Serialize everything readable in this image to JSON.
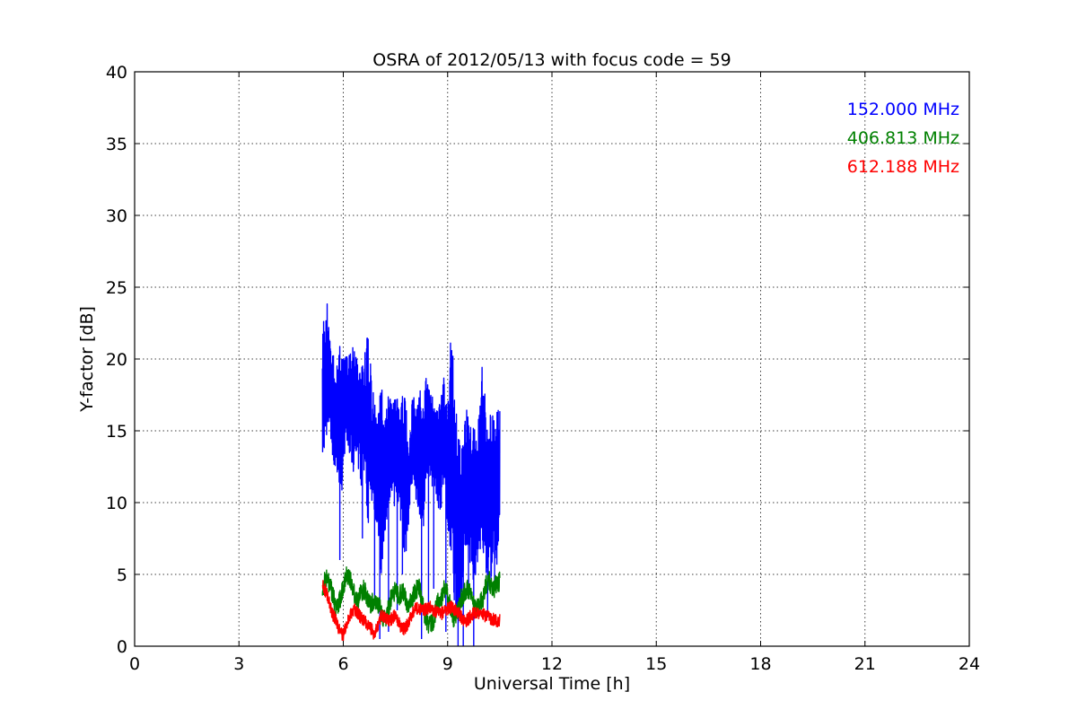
{
  "chart_data": {
    "type": "line",
    "title": "OSRA of 2012/05/13 with focus code = 59",
    "xlabel": "Universal Time [h]",
    "ylabel": "Y-factor [dB]",
    "xlim": [
      0,
      24
    ],
    "ylim": [
      0,
      40
    ],
    "xticks": [
      0,
      3,
      6,
      9,
      12,
      15,
      18,
      21,
      24
    ],
    "yticks": [
      0,
      5,
      10,
      15,
      20,
      25,
      30,
      35,
      40
    ],
    "grid": true,
    "legend_placement": "top-right",
    "series": [
      {
        "name": "152.000 MHz",
        "color": "#0000ff",
        "x": [
          5.4,
          5.5,
          5.6,
          5.7,
          5.8,
          5.9,
          6.0,
          6.1,
          6.2,
          6.3,
          6.4,
          6.5,
          6.6,
          6.7,
          6.8,
          6.9,
          7.0,
          7.1,
          7.2,
          7.3,
          7.4,
          7.5,
          7.6,
          7.7,
          7.8,
          7.9,
          8.0,
          8.1,
          8.2,
          8.3,
          8.4,
          8.5,
          8.6,
          8.7,
          8.8,
          8.9,
          9.0,
          9.1,
          9.2,
          9.3,
          9.4,
          9.5,
          9.6,
          9.7,
          9.8,
          9.9,
          10.0,
          10.1,
          10.2,
          10.3,
          10.4,
          10.5
        ],
        "min": [
          13.0,
          14.0,
          15.0,
          13.0,
          12.0,
          9.0,
          12.0,
          14.0,
          13.0,
          12.0,
          13.0,
          11.0,
          12.0,
          8.0,
          10.0,
          9.0,
          6.0,
          5.0,
          7.0,
          9.0,
          10.0,
          9.0,
          10.0,
          7.0,
          6.0,
          9.0,
          12.0,
          10.0,
          9.0,
          8.0,
          11.0,
          12.0,
          10.0,
          10.0,
          9.0,
          11.0,
          8.0,
          6.0,
          2.0,
          1.0,
          3.0,
          7.0,
          6.0,
          5.0,
          4.0,
          6.0,
          7.0,
          5.0,
          3.0,
          6.0,
          5.0,
          7.0
        ],
        "max": [
          22.0,
          25.0,
          22.0,
          21.0,
          20.0,
          21.5,
          21.0,
          21.0,
          20.5,
          21.0,
          20.0,
          20.5,
          19.5,
          23.5,
          19.0,
          17.0,
          18.0,
          18.0,
          18.0,
          17.5,
          17.0,
          18.0,
          16.5,
          18.0,
          17.5,
          14.0,
          18.0,
          17.5,
          18.0,
          17.0,
          19.5,
          18.0,
          17.5,
          16.5,
          17.5,
          19.0,
          16.0,
          23.8,
          18.0,
          15.5,
          14.0,
          17.0,
          16.0,
          15.5,
          15.0,
          16.0,
          20.0,
          16.5,
          16.0,
          17.0,
          16.5,
          16.8
        ],
        "spikes_down": [
          [
            5.9,
            6.0
          ],
          [
            6.55,
            7.5
          ],
          [
            6.9,
            3.0
          ],
          [
            7.05,
            0.5
          ],
          [
            7.3,
            1.0
          ],
          [
            7.55,
            2.5
          ],
          [
            7.7,
            5.0
          ],
          [
            8.25,
            0.5
          ],
          [
            8.45,
            3.0
          ],
          [
            8.6,
            4.0
          ],
          [
            8.95,
            1.0
          ],
          [
            9.3,
            0.0
          ],
          [
            9.45,
            0.0
          ],
          [
            9.6,
            4.0
          ],
          [
            9.75,
            0.0
          ],
          [
            10.15,
            2.0
          ],
          [
            10.35,
            4.0
          ]
        ]
      },
      {
        "name": "406.813 MHz",
        "color": "#008000",
        "x": [
          5.4,
          5.5,
          5.6,
          5.7,
          5.8,
          5.9,
          6.0,
          6.1,
          6.2,
          6.3,
          6.4,
          6.5,
          6.6,
          6.7,
          6.8,
          6.9,
          7.0,
          7.1,
          7.2,
          7.3,
          7.4,
          7.5,
          7.6,
          7.7,
          7.8,
          7.9,
          8.0,
          8.1,
          8.2,
          8.3,
          8.4,
          8.5,
          8.6,
          8.7,
          8.8,
          8.9,
          9.0,
          9.1,
          9.2,
          9.3,
          9.4,
          9.5,
          9.6,
          9.7,
          9.8,
          9.9,
          10.0,
          10.1,
          10.2,
          10.3,
          10.4,
          10.5
        ],
        "y": [
          4.0,
          4.8,
          4.3,
          3.5,
          2.6,
          3.2,
          4.0,
          5.0,
          4.7,
          3.8,
          3.2,
          3.6,
          4.0,
          3.4,
          2.9,
          3.2,
          3.0,
          2.2,
          1.8,
          2.6,
          3.6,
          3.9,
          3.5,
          3.8,
          3.2,
          2.8,
          3.4,
          4.0,
          4.1,
          2.6,
          1.8,
          1.4,
          1.9,
          3.0,
          3.2,
          4.1,
          3.6,
          2.5,
          1.8,
          2.5,
          3.4,
          3.8,
          4.0,
          3.1,
          2.6,
          2.9,
          3.2,
          4.2,
          4.5,
          3.9,
          4.3,
          4.5
        ],
        "band": 0.7
      },
      {
        "name": "612.188 MHz",
        "color": "#ff0000",
        "x": [
          5.4,
          5.5,
          5.6,
          5.7,
          5.8,
          5.9,
          6.0,
          6.1,
          6.2,
          6.3,
          6.4,
          6.5,
          6.6,
          6.7,
          6.8,
          6.9,
          7.0,
          7.1,
          7.2,
          7.3,
          7.4,
          7.5,
          7.6,
          7.7,
          7.8,
          7.9,
          8.0,
          8.1,
          8.2,
          8.3,
          8.4,
          8.5,
          8.6,
          8.7,
          8.8,
          8.9,
          9.0,
          9.1,
          9.2,
          9.3,
          9.4,
          9.5,
          9.6,
          9.7,
          9.8,
          9.9,
          10.0,
          10.1,
          10.2,
          10.3,
          10.4,
          10.5
        ],
        "y": [
          4.2,
          3.8,
          3.0,
          2.2,
          1.8,
          1.0,
          0.8,
          1.5,
          2.2,
          2.6,
          2.4,
          2.0,
          1.8,
          1.5,
          1.2,
          0.8,
          1.5,
          2.2,
          2.0,
          1.8,
          1.9,
          2.2,
          1.6,
          1.2,
          1.3,
          1.8,
          2.4,
          2.7,
          2.6,
          2.5,
          2.6,
          2.7,
          2.5,
          2.3,
          2.2,
          2.5,
          2.6,
          2.7,
          2.6,
          2.4,
          2.0,
          1.7,
          1.9,
          2.2,
          2.4,
          2.3,
          2.2,
          2.1,
          2.0,
          1.9,
          1.8,
          1.8
        ],
        "band": 0.45
      }
    ]
  }
}
